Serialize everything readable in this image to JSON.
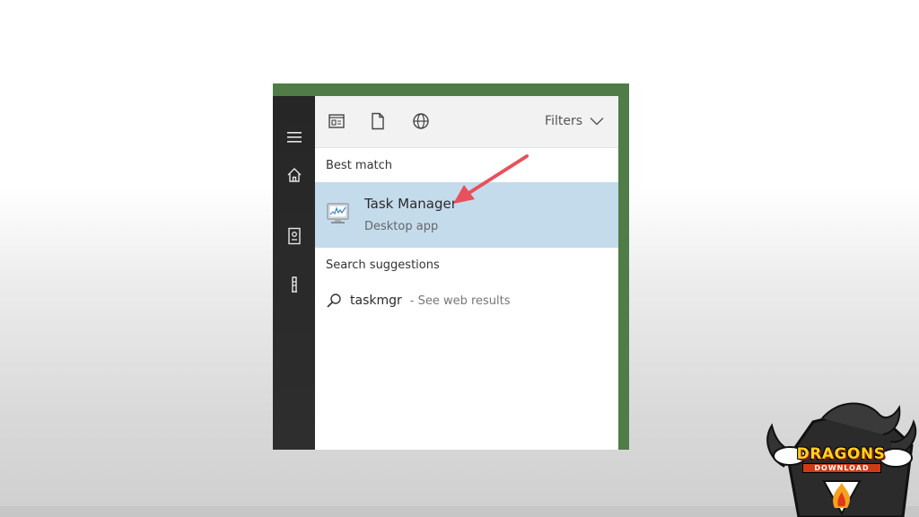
{
  "rail": {
    "items": [
      {
        "icon": "hamburger-menu-icon"
      },
      {
        "icon": "home-icon"
      },
      {
        "icon": "notebook-icon"
      },
      {
        "icon": "tower-icon"
      }
    ]
  },
  "topbar": {
    "icons": [
      "apps-filter-icon",
      "documents-filter-icon",
      "web-filter-icon"
    ],
    "filters_label": "Filters"
  },
  "best_match": {
    "section_label": "Best match",
    "title": "Task Manager",
    "subtitle": "Desktop app",
    "icon": "task-manager-icon"
  },
  "suggestions": {
    "section_label": "Search suggestions",
    "items": [
      {
        "query": "taskmgr",
        "suffix": "- See web results",
        "icon": "search-icon"
      }
    ]
  },
  "watermark": {
    "title": "DRAGONS",
    "subtitle": "DOWNLOAD"
  },
  "colors": {
    "accent_highlight": "#c4dbec",
    "rail_bg": "#2b2b2b",
    "window_frame": "#4f7c47",
    "annotation_arrow": "#e8505b"
  }
}
